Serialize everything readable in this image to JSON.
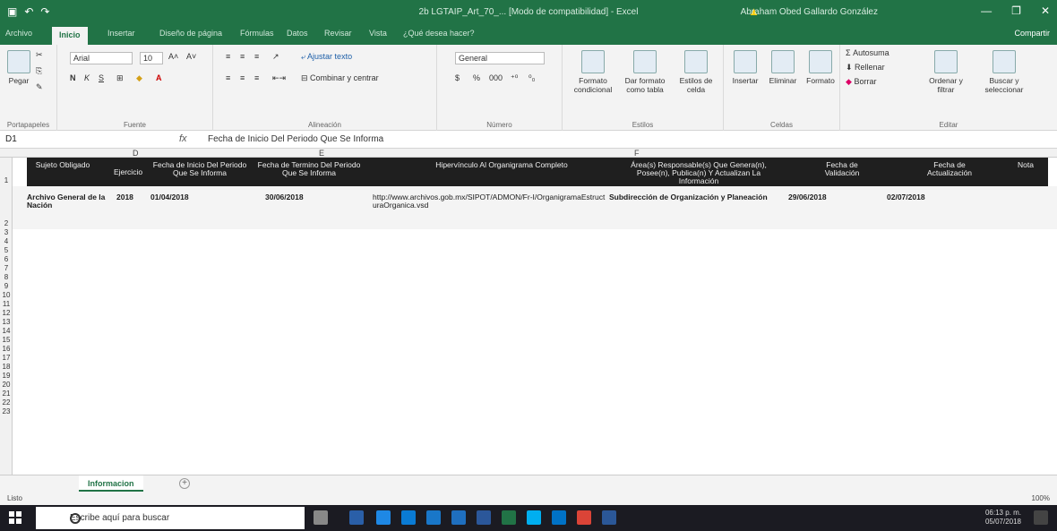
{
  "titlebar": {
    "title": "2b LGTAIP_Art_70_... [Modo de compatibilidad] - Excel",
    "user": "Abraham Obed Gallardo González"
  },
  "tabs": [
    "Archivo",
    "Inicio",
    "Insertar",
    "Diseño de página",
    "Fórmulas",
    "Datos",
    "Revisar",
    "Vista",
    "¿Qué desea hacer?"
  ],
  "share_label": "Compartir",
  "ribbon": {
    "clipboard": {
      "paste": "Pegar",
      "label": "Portapapeles"
    },
    "font": {
      "name": "Arial",
      "size": "10",
      "label": "Fuente",
      "bold": "N",
      "italic": "K",
      "underline": "S"
    },
    "alignment": {
      "wrap": "Ajustar texto",
      "merge": "Combinar y centrar",
      "label": "Alineación"
    },
    "number": {
      "format": "General",
      "label": "Número"
    },
    "styles": {
      "conditional": "Formato condicional",
      "table": "Dar formato como tabla",
      "cell": "Estilos de celda",
      "label": "Estilos"
    },
    "cells": {
      "insert": "Insertar",
      "delete": "Eliminar",
      "format": "Formato",
      "label": "Celdas"
    },
    "editing": {
      "autosum": "Autosuma",
      "fill": "Rellenar",
      "clear": "Borrar",
      "sort": "Ordenar y filtrar",
      "find": "Buscar y seleccionar",
      "label": "Editar"
    }
  },
  "formula_bar": {
    "namebox": "D1",
    "fx": "fx",
    "value": "Fecha de Inicio Del Periodo Que Se Informa"
  },
  "grid": {
    "columns": [
      "D",
      "E",
      "F"
    ],
    "header_row": [
      "Sujeto Obligado",
      "Ejercicio",
      "Fecha de Inicio Del Periodo Que Se Informa",
      "Fecha de Termino Del Periodo Que Se Informa",
      "Hipervínculo Al Organigrama Completo",
      "Área(s) Responsable(s) Que Genera(n), Posee(n), Publica(n) Y Actualizan La Información",
      "Fecha de Validación",
      "Fecha de Actualización",
      "Nota"
    ],
    "data_row": [
      "Archivo General de la Nación",
      "2018",
      "01/04/2018",
      "30/06/2018",
      "http://www.archivos.gob.mx/SIPOT/ADMON/Fr-I/OrganigramaEstructuraOrganica.vsd",
      "Subdirección de Organización y Planeación",
      "29/06/2018",
      "02/07/2018",
      ""
    ],
    "row_numbers": [
      "1",
      "2",
      "3",
      "4",
      "5",
      "6",
      "7",
      "8",
      "9",
      "10",
      "11",
      "12",
      "13",
      "14",
      "15",
      "16",
      "17",
      "18",
      "19",
      "20",
      "21",
      "22",
      "23"
    ]
  },
  "sheet": {
    "tab": "Informacion",
    "add": "+"
  },
  "status": {
    "text": "Listo",
    "zoom": "100%"
  },
  "taskbar": {
    "search_placeholder": "Escribe aquí para buscar",
    "time": "06:13 p. m.",
    "date": "05/07/2018"
  }
}
